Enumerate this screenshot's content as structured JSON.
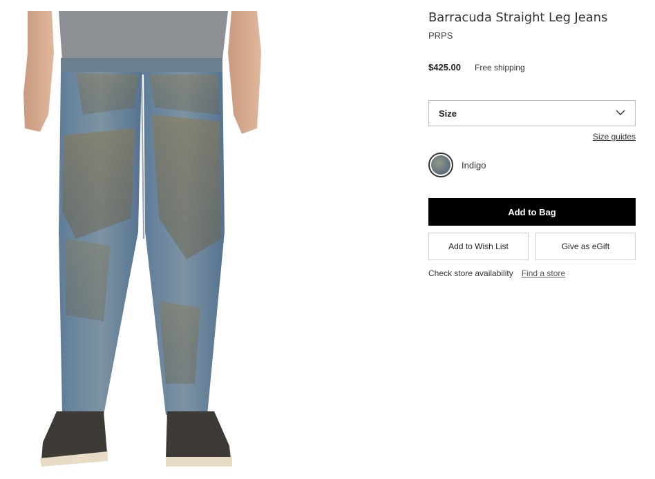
{
  "product": {
    "title": "Barracuda Straight Leg Jeans",
    "brand": "PRPS",
    "price": "$425.00",
    "shipping": "Free shipping"
  },
  "size": {
    "label": "Size",
    "icon": "chevron-down-icon",
    "guides_link": "Size guides"
  },
  "color": {
    "name": "Indigo",
    "swatch_color": "#6f7d80"
  },
  "actions": {
    "add_to_bag": "Add to Bag",
    "wish_list": "Add to Wish List",
    "egift": "Give as eGift"
  },
  "store": {
    "check_label": "Check store availability",
    "find_link": "Find a store"
  },
  "colors": {
    "primary_button": "#000000",
    "border": "#bbbbbb"
  }
}
